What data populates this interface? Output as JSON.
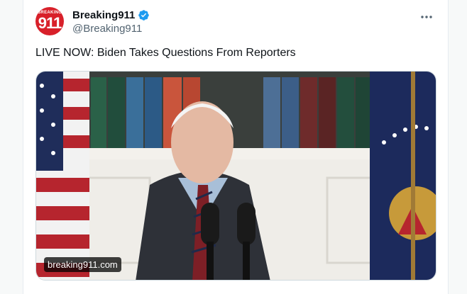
{
  "account": {
    "display_name": "Breaking911",
    "handle": "@Breaking911",
    "avatar_small_text": "BREAKING",
    "avatar_number": "911",
    "verified": true
  },
  "tweet": {
    "text": "LIVE NOW: Biden Takes Questions From Reporters"
  },
  "media": {
    "link_label": "breaking911.com"
  },
  "colors": {
    "verified_blue": "#1d9bf0",
    "avatar_red": "#d8202a",
    "handle_gray": "#536471"
  },
  "icons": {
    "verified": "verified-badge-icon",
    "more": "more-horizontal-icon"
  }
}
